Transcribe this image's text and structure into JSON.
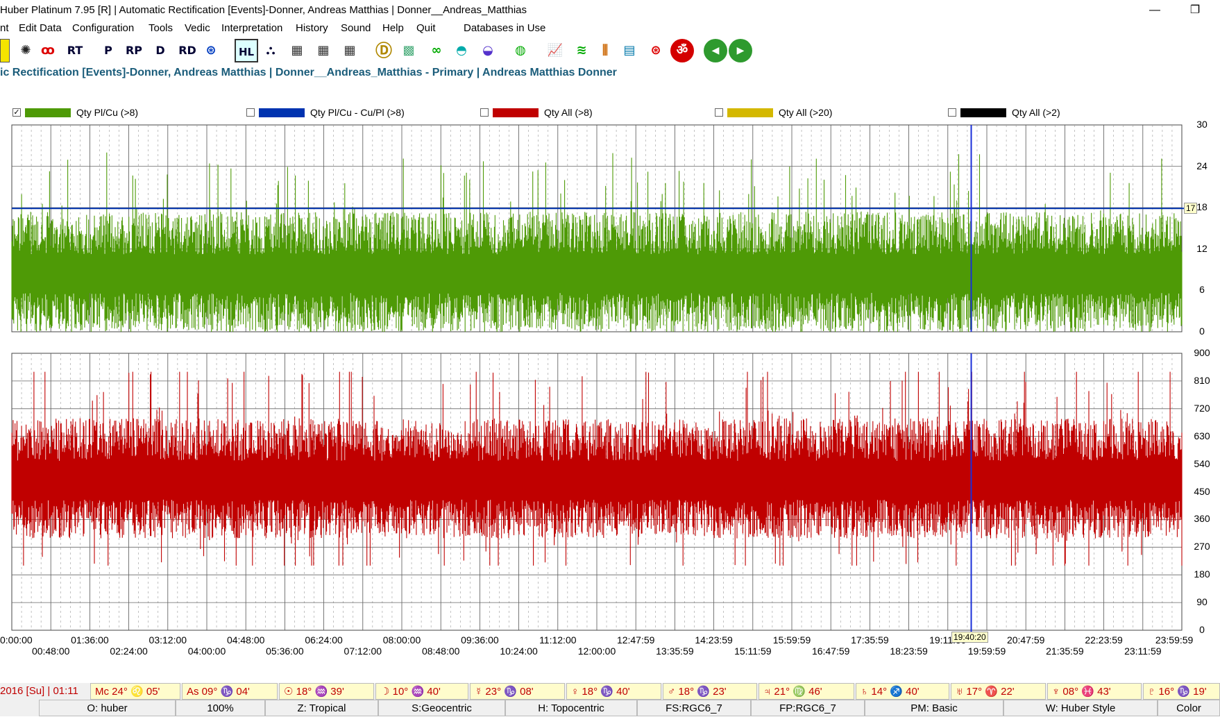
{
  "window": {
    "title": "Huber Platinum 7.95 [R] | Automatic Rectification [Events]-Donner, Andreas Matthias | Donner__Andreas_Matthias",
    "minimize": "—",
    "restore": "❐"
  },
  "menu": [
    "nt",
    "Edit Data",
    "Configuration",
    "Tools",
    "Vedic",
    "Interpretation",
    "History",
    "Sound",
    "Help",
    "Quit",
    "Databases in Use"
  ],
  "toolbar": {
    "buttons": [
      {
        "name": "yellow-square-icon",
        "glyph": "",
        "color": "#f5e400"
      },
      {
        "name": "wheel-chart-icon",
        "glyph": "✺",
        "color": "#222"
      },
      {
        "name": "three-circles-icon",
        "glyph": "ꝏ",
        "color": "#d00"
      },
      {
        "name": "rt-icon",
        "glyph": "RT",
        "color": "#003"
      },
      {
        "name": "p-icon",
        "glyph": "P",
        "color": "#003"
      },
      {
        "name": "rp-icon",
        "glyph": "RP",
        "color": "#003"
      },
      {
        "name": "d-icon",
        "glyph": "D",
        "color": "#003"
      },
      {
        "name": "rd-icon",
        "glyph": "RD",
        "color": "#003"
      },
      {
        "name": "lifebuoy-blue-icon",
        "glyph": "⊛",
        "color": "#003cc0"
      },
      {
        "name": "hl-icon",
        "glyph": "HL",
        "color": "#003"
      },
      {
        "name": "family-icon",
        "glyph": "⛬",
        "color": "#003"
      },
      {
        "name": "table-icon-1",
        "glyph": "▦",
        "color": "#333"
      },
      {
        "name": "table-icon-2",
        "glyph": "▦",
        "color": "#333"
      },
      {
        "name": "table-icon-3",
        "glyph": "▦",
        "color": "#333"
      },
      {
        "name": "d-circle-icon",
        "glyph": "Ⓓ",
        "color": "#b08800"
      },
      {
        "name": "grid-map-icon",
        "glyph": "▩",
        "color": "#4a7"
      },
      {
        "name": "infinity-icon",
        "glyph": "∞",
        "color": "#0a0"
      },
      {
        "name": "half-circle-cyan-icon",
        "glyph": "◓",
        "color": "#0aa"
      },
      {
        "name": "half-circle-purple-icon",
        "glyph": "◒",
        "color": "#53c"
      },
      {
        "name": "green-circle-icon",
        "glyph": "◍",
        "color": "#0a0"
      },
      {
        "name": "line-chart-icon",
        "glyph": "📈",
        "color": "#a00"
      },
      {
        "name": "multi-line-icon",
        "glyph": "≋",
        "color": "#0a0"
      },
      {
        "name": "bar-people-icon",
        "glyph": "⫼",
        "color": "#c60"
      },
      {
        "name": "map-chart-icon",
        "glyph": "▤",
        "color": "#07a"
      },
      {
        "name": "lifebuoy-red-icon",
        "glyph": "⊛",
        "color": "#d00"
      },
      {
        "name": "om-icon",
        "glyph": "ॐ",
        "color": "#fff"
      },
      {
        "name": "back-arrow-icon",
        "glyph": "◀",
        "color": "#fff"
      },
      {
        "name": "forward-arrow-icon",
        "glyph": "▶",
        "color": "#fff"
      }
    ]
  },
  "subtitle": "ic Rectification [Events]-Donner, Andreas Matthias | Donner__Andreas_Matthias - Primary | Andreas Matthias Donner",
  "legend": [
    {
      "label": "Qty Pl/Cu (>8)",
      "color": "#4e9a06",
      "checked": true
    },
    {
      "label": "Qty Pl/Cu - Cu/Pl (>8)",
      "color": "#0033b0",
      "checked": false
    },
    {
      "label": "Qty All (>8)",
      "color": "#c00000",
      "checked": false
    },
    {
      "label": "Qty All (>20)",
      "color": "#d4b800",
      "checked": false
    },
    {
      "label": "Qty All (>2)",
      "color": "#000000",
      "checked": false
    }
  ],
  "chart_data": [
    {
      "type": "line",
      "series": [
        {
          "name": "Qty Pl/Cu (>8)",
          "color": "#4e9a06",
          "mean": 9,
          "min": 0,
          "max": 28
        }
      ],
      "ylim": [
        0,
        30
      ],
      "yticks": [
        "30",
        "24",
        "18",
        "12",
        "6",
        "0"
      ],
      "threshold": {
        "label": "17",
        "value": 17.9
      },
      "cursor_time_fraction": 0.82
    },
    {
      "type": "line",
      "series": [
        {
          "name": "Qty All (>8)",
          "color": "#c00000",
          "mean": 500,
          "min": 210,
          "max": 840
        }
      ],
      "ylim": [
        0,
        900
      ],
      "yticks": [
        "900",
        "810",
        "720",
        "630",
        "540",
        "450",
        "360",
        "270",
        "180",
        "90",
        "0"
      ],
      "cursor_time_fraction": 0.82
    }
  ],
  "xaxis": {
    "top_ticks": [
      "0:00:00",
      "01:36:00",
      "03:12:00",
      "04:48:00",
      "06:24:00",
      "08:00:00",
      "09:36:00",
      "11:12:00",
      "12:47:59",
      "14:23:59",
      "15:59:59",
      "17:35:59",
      "19:11:59",
      "20:47:59",
      "22:23:59",
      "23:59:59"
    ],
    "bottom_ticks": [
      "00:48:00",
      "02:24:00",
      "04:00:00",
      "05:36:00",
      "07:12:00",
      "08:48:00",
      "10:24:00",
      "12:00:00",
      "13:35:59",
      "15:11:59",
      "16:47:59",
      "18:23:59",
      "19:59:59",
      "21:35:59",
      "23:11:59"
    ],
    "cursor_label": "19:40:20"
  },
  "planets": {
    "date": "2016 [Su] | 01:11",
    "cells": [
      {
        "label": "Mc 24° ♌ 05'",
        "name": "mc"
      },
      {
        "label": "As 09° ♑ 04'",
        "name": "asc"
      },
      {
        "label": "☉ 18° ♒ 39'",
        "name": "sun"
      },
      {
        "label": "☽ 10° ♒ 40'",
        "name": "moon"
      },
      {
        "label": "☿ 23° ♑ 08'",
        "name": "mercury"
      },
      {
        "label": "♀ 18° ♑ 40'",
        "name": "venus"
      },
      {
        "label": "♂ 18° ♑ 23'",
        "name": "mars"
      },
      {
        "label": "♃ 21° ♍ 46'",
        "name": "jupiter"
      },
      {
        "label": "♄ 14° ♐ 40'",
        "name": "saturn"
      },
      {
        "label": "♅ 17° ♈ 22'",
        "name": "uranus"
      },
      {
        "label": "♆ 08° ♓ 43'",
        "name": "neptune"
      },
      {
        "label": "♇ 16° ♑ 19'",
        "name": "pluto"
      }
    ]
  },
  "status": [
    {
      "label": "O: huber",
      "name": "status-owner"
    },
    {
      "label": "100%",
      "name": "status-zoom"
    },
    {
      "label": "Z: Tropical",
      "name": "status-zodiac"
    },
    {
      "label": "S:Geocentric",
      "name": "status-system"
    },
    {
      "label": "H: Topocentric",
      "name": "status-house"
    },
    {
      "label": "FS:RGC6_7",
      "name": "status-fs"
    },
    {
      "label": "FP:RGC6_7",
      "name": "status-fp"
    },
    {
      "label": "PM: Basic",
      "name": "status-pm"
    },
    {
      "label": "W: Huber Style",
      "name": "status-w"
    },
    {
      "label": "Color",
      "name": "status-color"
    }
  ]
}
